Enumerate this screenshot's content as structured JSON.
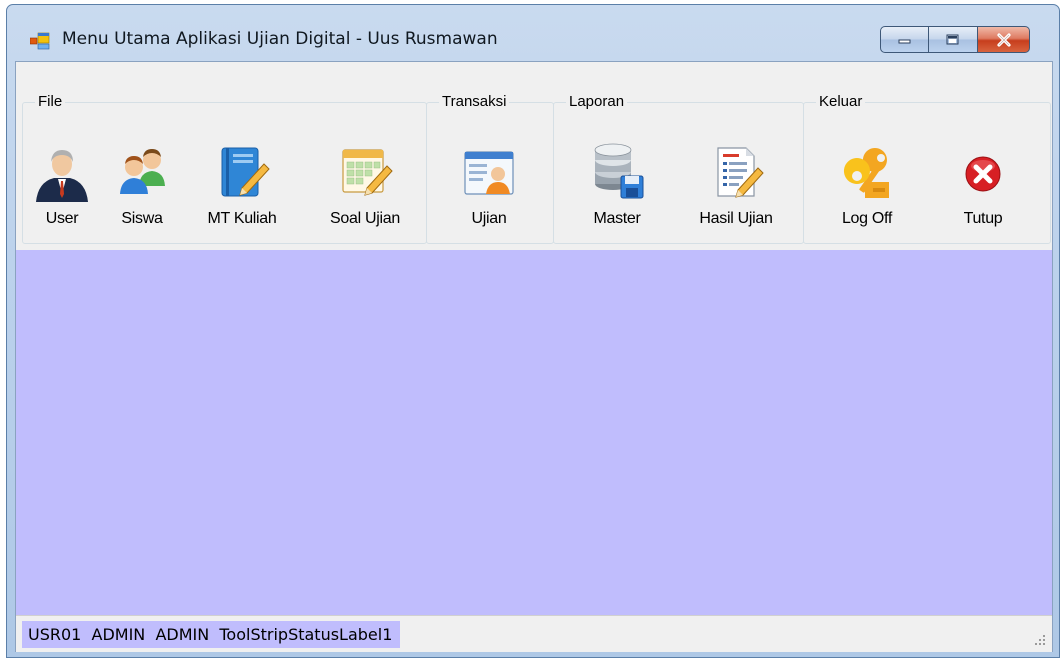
{
  "window": {
    "title": "Menu Utama Aplikasi Ujian Digital - Uus Rusmawan",
    "controls": [
      "minimize-icon",
      "maximize-icon",
      "close-icon"
    ],
    "accent_close": "#c73e1d"
  },
  "toolbar": {
    "groups": [
      {
        "label": "File",
        "buttons": [
          {
            "label": "User",
            "icon": "user-icon"
          },
          {
            "label": "Siswa",
            "icon": "students-icon"
          },
          {
            "label": "MT Kuliah",
            "icon": "notebook-icon"
          },
          {
            "label": "Soal Ujian",
            "icon": "calendar-edit-icon"
          }
        ]
      },
      {
        "label": "Transaksi",
        "buttons": [
          {
            "label": "Ujian",
            "icon": "exam-card-icon"
          }
        ]
      },
      {
        "label": "Laporan",
        "buttons": [
          {
            "label": "Master",
            "icon": "database-save-icon"
          },
          {
            "label": "Hasil Ujian",
            "icon": "report-edit-icon"
          }
        ]
      },
      {
        "label": "Keluar",
        "buttons": [
          {
            "label": "Log Off",
            "icon": "keys-icon"
          },
          {
            "label": "Tutup",
            "icon": "close-circle-icon"
          }
        ]
      }
    ]
  },
  "main": {
    "background": "#c0bdfd"
  },
  "status_bar": {
    "text": "USR01  ADMIN  ADMIN  ToolStripStatusLabel1"
  }
}
